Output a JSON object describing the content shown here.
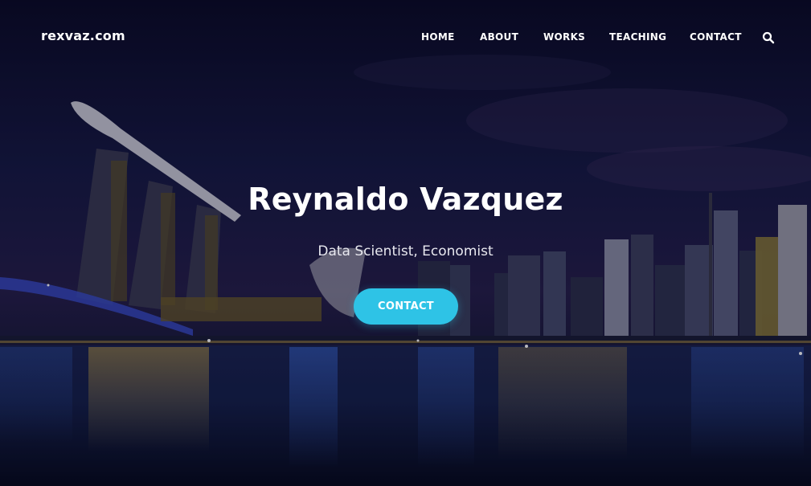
{
  "site": {
    "brand": "rexvaz.com"
  },
  "nav": {
    "items": [
      {
        "label": "HOME"
      },
      {
        "label": "ABOUT"
      },
      {
        "label": "WORKS"
      },
      {
        "label": "TEACHING"
      },
      {
        "label": "CONTACT"
      }
    ],
    "search_icon": "search-icon"
  },
  "hero": {
    "title": "Reynaldo Vazquez",
    "subtitle": "Data Scientist, Economist",
    "cta_label": "CONTACT",
    "background": "night city skyline with waterfront reflections"
  },
  "colors": {
    "accent": "#2ec3e6",
    "text": "#ffffff",
    "background": "#14163a"
  }
}
